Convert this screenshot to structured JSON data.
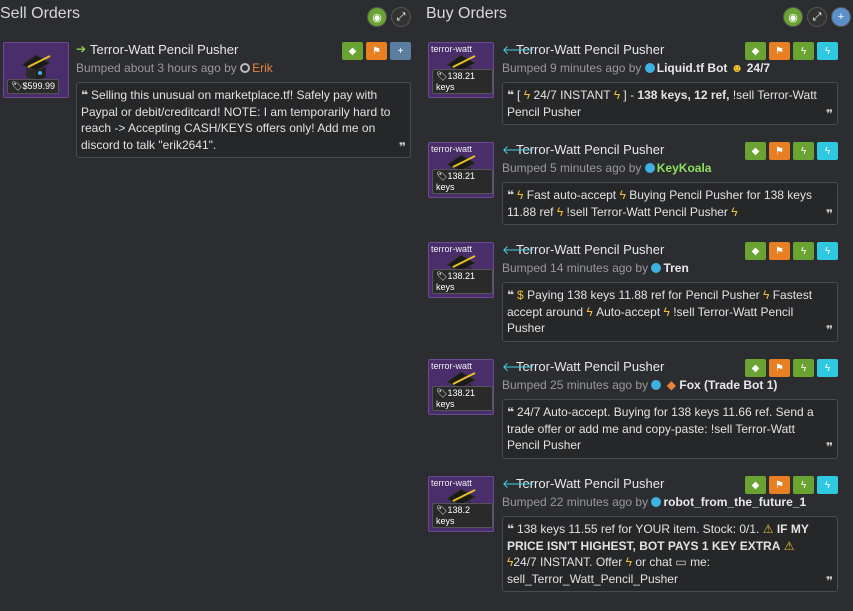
{
  "sell": {
    "title": "Sell Orders",
    "listings": [
      {
        "item_name": "Terror-Watt Pencil Pusher",
        "price": "$599.99",
        "bumped": "Bumped about 3 hours ago by",
        "user": "Erik",
        "message": "Selling this unusual on marketplace.tf! Safely pay with Paypal or debit/creditcard! NOTE: I am temporarily hard to reach -> Accepting CASH/KEYS offers only! Add me on discord to talk \"erik2641\"."
      }
    ]
  },
  "buy": {
    "title": "Buy Orders",
    "listings": [
      {
        "item_tag": "terror-watt",
        "item_name": "Terror-Watt Pencil Pusher",
        "price": "138.21 keys",
        "bumped": "Bumped 9 minutes ago by",
        "user": "Liquid.tf Bot",
        "user_suffix": "24/7",
        "msg_a": "[",
        "msg_b": "24/7 INSTANT",
        "msg_c": "] -",
        "msg_d": "138 keys, 12 ref,",
        "msg_e": "!sell Terror-Watt Pencil Pusher"
      },
      {
        "item_tag": "terror-watt",
        "item_name": "Terror-Watt Pencil Pusher",
        "price": "138.21 keys",
        "bumped": "Bumped 5 minutes ago by",
        "user": "KeyKoala",
        "msg_a": "Fast auto-accept",
        "msg_b": "Buying Pencil Pusher for 138 keys 11.88 ref",
        "msg_c": "!sell Terror-Watt Pencil Pusher"
      },
      {
        "item_tag": "terror-watt",
        "item_name": "Terror-Watt Pencil Pusher",
        "price": "138.21 keys",
        "bumped": "Bumped 14 minutes ago by",
        "user": "Tren",
        "msg_a": "Paying 138 keys 11.88 ref for Pencil Pusher",
        "msg_b": "Fastest accept around",
        "msg_c": "Auto-accept",
        "msg_d": "!sell Terror-Watt Pencil Pusher"
      },
      {
        "item_tag": "terror-watt",
        "item_name": "Terror-Watt Pencil Pusher",
        "price": "138.21 keys",
        "bumped": "Bumped 25 minutes ago by",
        "user": "Fox (Trade Bot 1)",
        "message": "24/7 Auto-accept. Buying for 138 keys 11.66 ref. Send a trade offer or add me and copy-paste: !sell Terror-Watt Pencil Pusher"
      },
      {
        "item_tag": "terror-watt",
        "item_name": "Terror-Watt Pencil Pusher",
        "price": "138.2 keys",
        "bumped": "Bumped 22 minutes ago by",
        "user": "robot_from_the_future_1",
        "msg_a": "138 keys 11.55 ref for YOUR item. Stock: 0/1.",
        "msg_b": "IF MY PRICE ISN'T HIGHEST, BOT PAYS 1 KEY EXTRA",
        "msg_c": "24/7 INSTANT. Offer",
        "msg_d": "or chat",
        "msg_e": "me: sell_Terror_Watt_Pencil_Pusher"
      }
    ]
  },
  "icons": {
    "item_arrow_sell": "arrow-right-icon",
    "item_arrow_buy": "arrow-left-icon",
    "price_tag": "tag-icon",
    "quote": "quote-icon",
    "lightning": "lightning-icon",
    "flag": "flag-icon",
    "add_friend": "user-plus-icon",
    "eye": "eye-icon",
    "expand": "expand-icon",
    "plus": "plus-icon"
  },
  "colors": {
    "background": "#2b2d31",
    "green": "#6aa331",
    "orange": "#e87f22",
    "cyan": "#2ec8e0",
    "item_bg": "#4a2e6b"
  }
}
